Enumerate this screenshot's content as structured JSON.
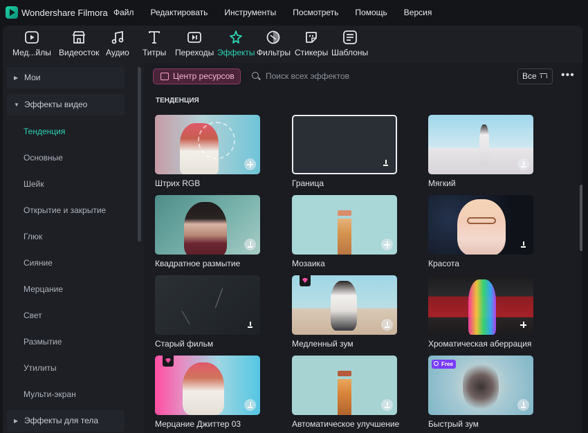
{
  "app": {
    "title": "Wondershare Filmora"
  },
  "menu": [
    "Файл",
    "Редактировать",
    "Инструменты",
    "Посмотреть",
    "Помощь",
    "Версия"
  ],
  "toolbar": {
    "items": [
      {
        "label": "Мед...йлы",
        "icon": "media-icon"
      },
      {
        "label": "Видеосток",
        "icon": "stock-store-icon"
      },
      {
        "label": "Аудио",
        "icon": "music-note-icon"
      },
      {
        "label": "Титры",
        "icon": "text-t-icon"
      },
      {
        "label": "Переходы",
        "icon": "transition-icon"
      },
      {
        "label": "Эффекты",
        "icon": "effects-sparkle-icon",
        "active": true
      },
      {
        "label": "Фильтры",
        "icon": "filter-icon"
      },
      {
        "label": "Стикеры",
        "icon": "sticker-icon"
      },
      {
        "label": "Шаблоны",
        "icon": "template-icon"
      }
    ]
  },
  "sidebar": {
    "categories": [
      "Мои",
      "Эффекты видео",
      "Эффекты для тела"
    ],
    "subitems": [
      "Тенденция",
      "Основные",
      "Шейк",
      "Открытие и закрытие",
      "Глюк",
      "Сияние",
      "Мерцание",
      "Свет",
      "Размытие",
      "Утилиты",
      "Мульти-экран"
    ]
  },
  "content": {
    "resource_center": "Центр ресурсов",
    "search_placeholder": "Поиск всех эффектов",
    "filter_label": "Все",
    "more": "•••",
    "section_title": "ТЕНДЕНЦИЯ",
    "cards": [
      {
        "label": "Штрих RGB",
        "badge": "add"
      },
      {
        "label": "Граница",
        "badge": "download"
      },
      {
        "label": "Мягкий",
        "badge": "download"
      },
      {
        "label": "Квадратное размытие",
        "badge": "download"
      },
      {
        "label": "Мозаика",
        "badge": "add"
      },
      {
        "label": "Красота",
        "badge": "download"
      },
      {
        "label": "Старый фильм",
        "badge": "download"
      },
      {
        "label": "Медленный зум",
        "badge": "download",
        "premium": true
      },
      {
        "label": "Хроматическая аберрация",
        "badge": "add"
      },
      {
        "label": "Мерцание Джиттер 03",
        "badge": "download",
        "premium": true
      },
      {
        "label": "Автоматическое улучшение",
        "badge": "download"
      },
      {
        "label": "Быстрый зум",
        "badge": "download",
        "free_tag": "Free"
      }
    ]
  },
  "colors": {
    "accent": "#2ED3B0",
    "resource_center": "#F3B3D3",
    "background": "#1D1F25"
  }
}
